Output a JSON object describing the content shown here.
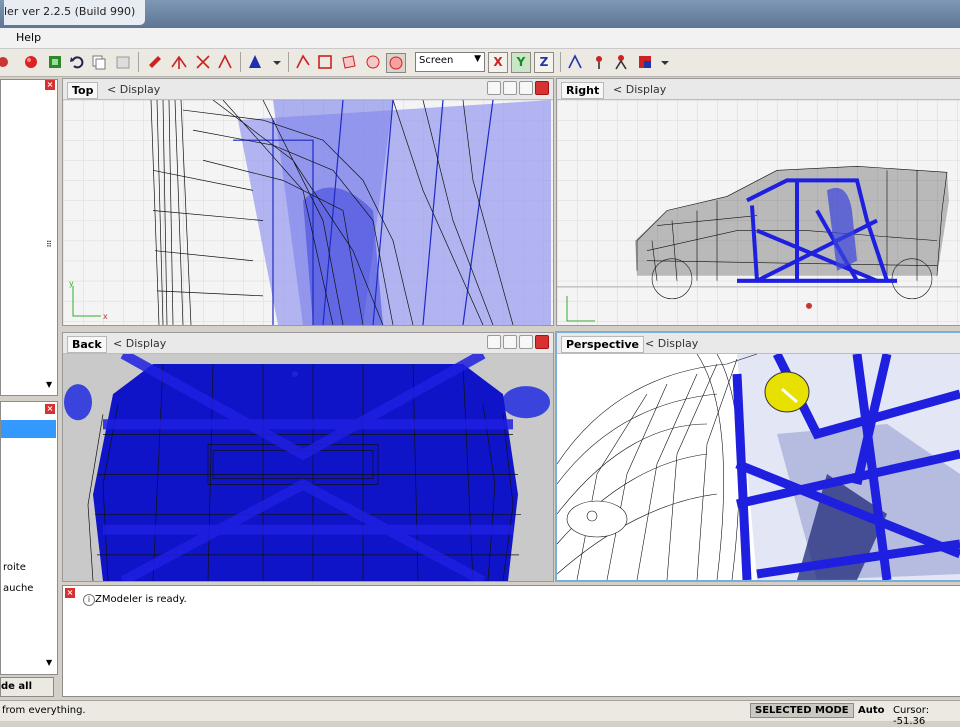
{
  "window": {
    "title": "ler ver 2.2.5 (Build 990)"
  },
  "menu": {
    "help": "Help"
  },
  "toolbar": {
    "coord_select": "Screen",
    "axis_x": "X",
    "axis_y": "Y",
    "axis_z": "Z"
  },
  "left_panel": {
    "items": [
      "roite",
      "auche"
    ],
    "button_label": "de all"
  },
  "viewports": {
    "top": {
      "name": "Top",
      "display": "Display"
    },
    "right": {
      "name": "Right",
      "display": "Display"
    },
    "back": {
      "name": "Back",
      "display": "Display"
    },
    "perspective": {
      "name": "Perspective",
      "display": "Display"
    }
  },
  "log": {
    "message": "ZModeler is ready."
  },
  "status": {
    "left_text": "from everything.",
    "mode": "SELECTED MODE",
    "auto": "Auto",
    "cursor": "Cursor: -51.36"
  },
  "colors": {
    "accent_blue": "#1f1fe0",
    "selection_yellow": "#e8e000",
    "title_bar": "#6a83a1"
  }
}
